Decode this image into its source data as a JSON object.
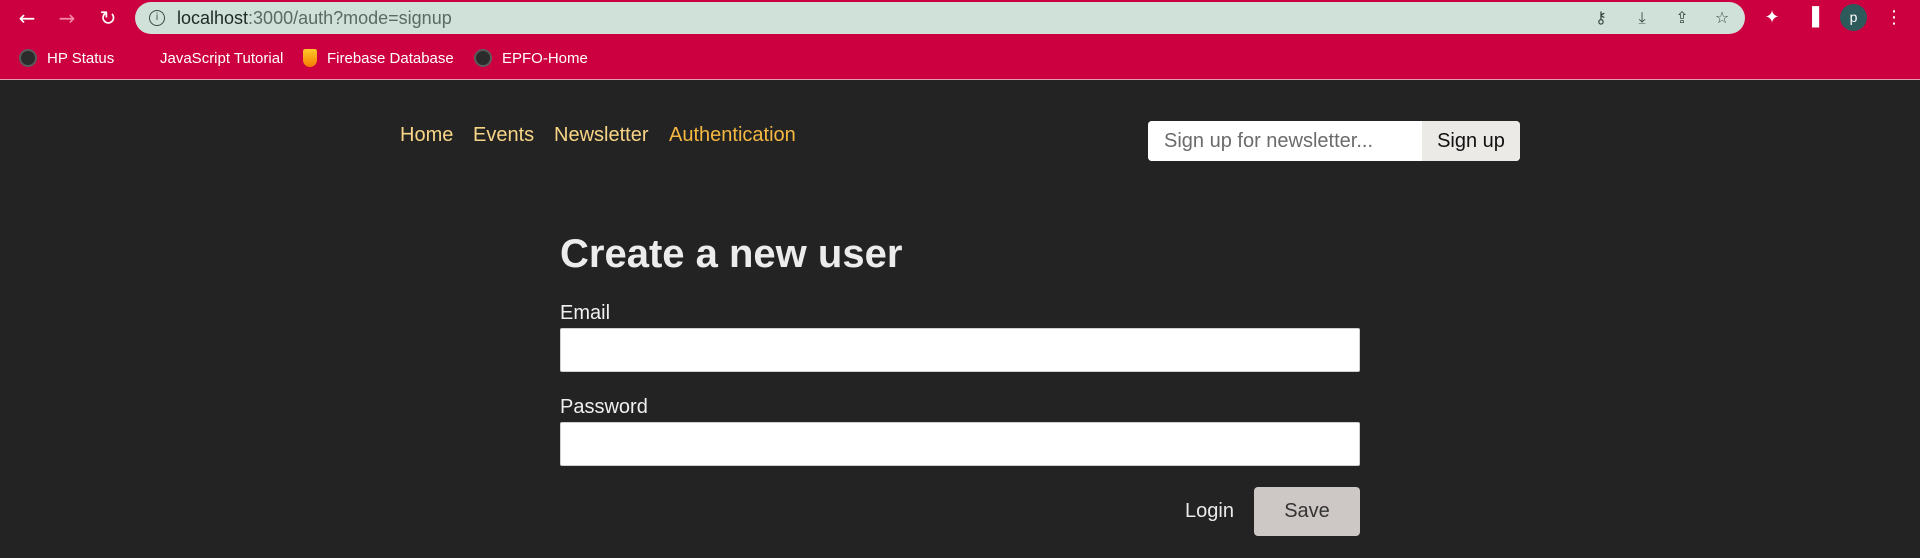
{
  "browser": {
    "url_host": "localhost",
    "url_path": ":3000/auth?mode=signup",
    "profile_initial": "p",
    "bookmarks": [
      {
        "label": "HP Status",
        "icon": "globe-icon"
      },
      {
        "label": "JavaScript Tutorial",
        "icon": "bookmark-icon"
      },
      {
        "label": "Firebase Database",
        "icon": "firebase-icon"
      },
      {
        "label": "EPFO-Home",
        "icon": "globe-icon"
      }
    ]
  },
  "nav": {
    "items": [
      {
        "label": "Home"
      },
      {
        "label": "Events"
      },
      {
        "label": "Newsletter"
      },
      {
        "label": "Authentication",
        "active": true
      }
    ]
  },
  "newsletter": {
    "placeholder": "Sign up for newsletter...",
    "value": "",
    "button_label": "Sign up"
  },
  "form": {
    "title": "Create a new user",
    "email_label": "Email",
    "email_value": "",
    "password_label": "Password",
    "password_value": "",
    "login_label": "Login",
    "save_label": "Save"
  },
  "colors": {
    "browser_accent": "#cc0040",
    "page_background": "#232323",
    "nav_link": "#f8d586",
    "nav_active": "#f5b841"
  }
}
